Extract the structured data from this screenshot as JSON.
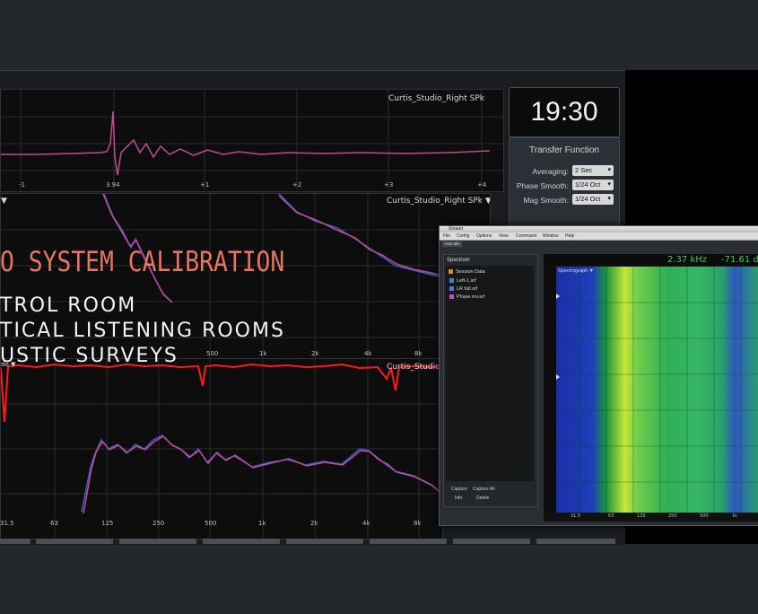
{
  "main": {
    "trace_top": "Curtis_Studio_Right SPk",
    "trace_mid": "Curtis_Studio_Right SPk ▼",
    "trace_phase": "Curtis_Studio",
    "top_ticks": [
      "-1",
      "3.94",
      "+1",
      "+2",
      "+3",
      "+4"
    ],
    "mid_freq_ticks": [
      "500",
      "1k",
      "2k",
      "4k",
      "8k"
    ],
    "bottom_freq_ticks": [
      "31.5",
      "63",
      "125",
      "250",
      "500",
      "1k",
      "2k",
      "4k",
      "8k"
    ],
    "mid_left_marker": "▼",
    "phase_left_label": "de ▼"
  },
  "side_panel": {
    "clock": "19:30",
    "tf_title": "Transfer Function",
    "rows": [
      {
        "label": "Averaging:",
        "value": "2 Sec"
      },
      {
        "label": "Phase Smooth:",
        "value": "1/24 Oct"
      },
      {
        "label": "Mag Smooth:",
        "value": "1/24 Oct"
      }
    ]
  },
  "overlay": {
    "title": "O SYSTEM CALIBRATION",
    "items": [
      "TROL ROOM",
      "TICAL LISTENING ROOMS",
      "USTIC SURVEYS"
    ]
  },
  "smaart": {
    "app_title": "Smaart",
    "menus": [
      "File",
      "Config",
      "Options",
      "View",
      "Command",
      "Window",
      "Help"
    ],
    "tab": "new tab",
    "panel_header": "Spectrum",
    "session_label": "Session Data",
    "session_items": [
      {
        "name": "Left-1.srf",
        "color": "#4a7bd8"
      },
      {
        "name": "LR full.srf",
        "color": "#4a7bd8"
      },
      {
        "name": "Phase inv.srf",
        "color": "#c74fc0"
      }
    ],
    "capture": "Capture",
    "capture_all": "Capture All",
    "info": "Info",
    "delete": "Delete",
    "readout_freq": "2.37 kHz",
    "readout_level": "-71.61 dB",
    "spectrograph_label": "Spectrograph ▼",
    "freq_ticks": [
      "31.5",
      "63",
      "125",
      "250",
      "500",
      "1k"
    ]
  }
}
